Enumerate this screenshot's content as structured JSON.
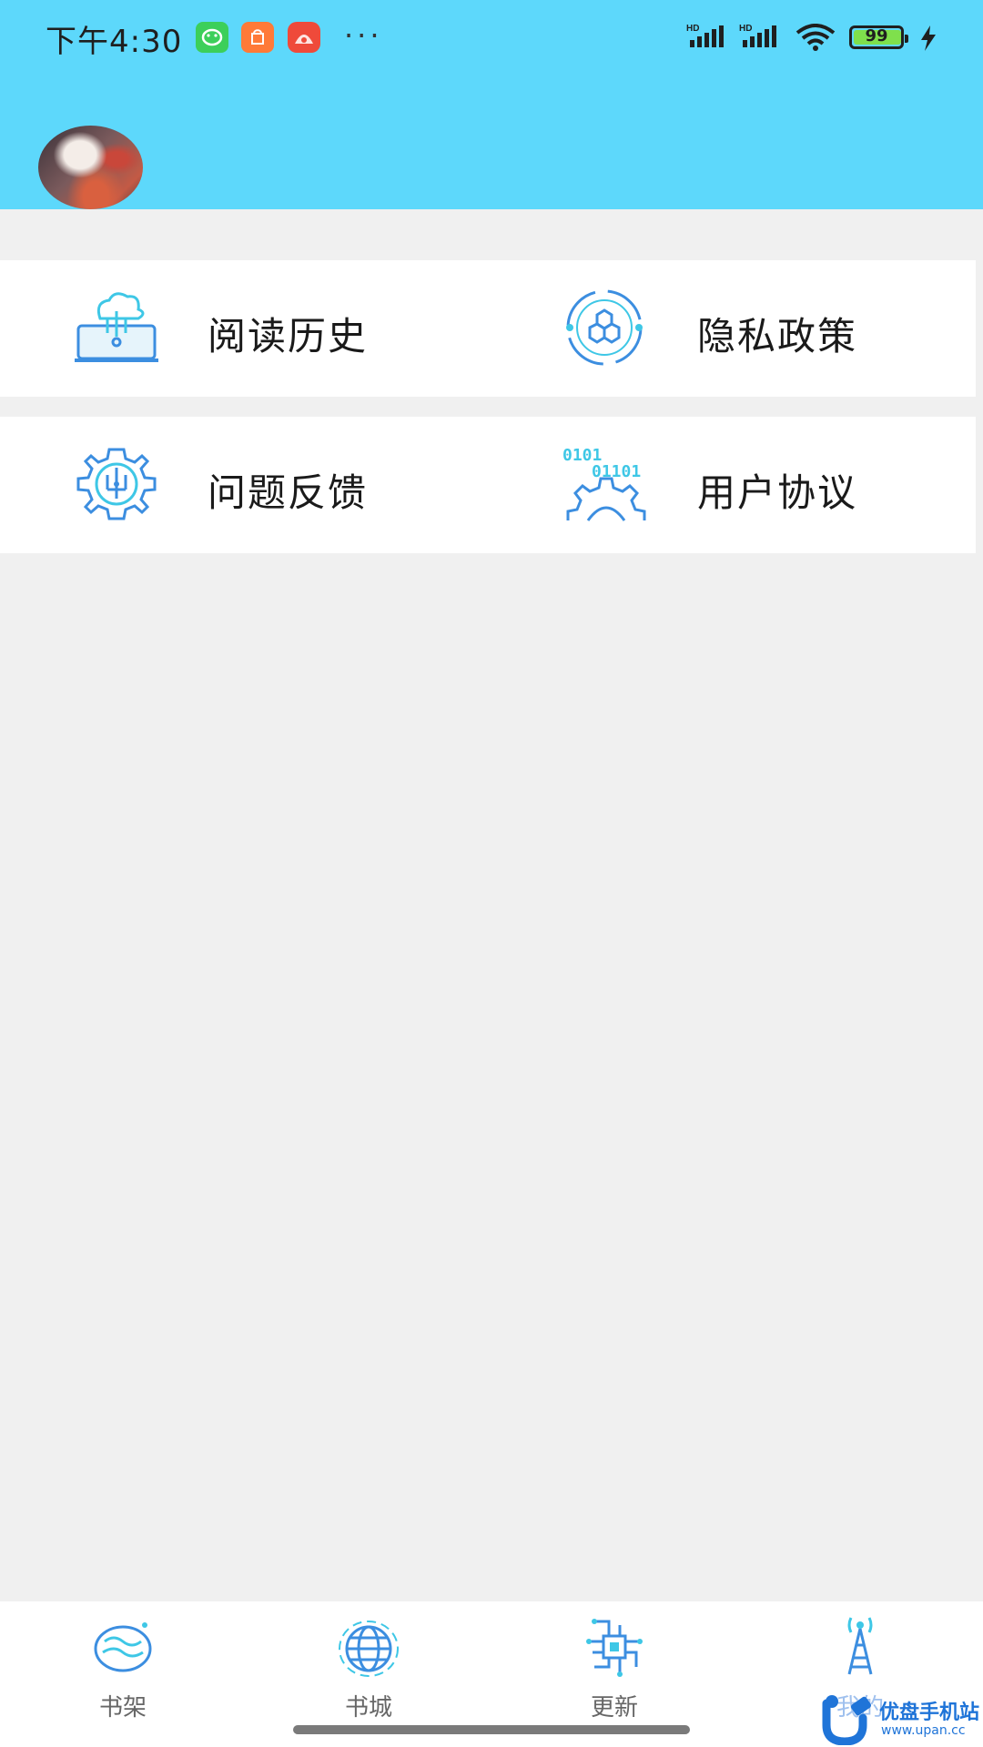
{
  "status_bar": {
    "time": "下午4:30",
    "more": "···",
    "battery_level": "99",
    "network_labels": [
      "HD",
      "HD"
    ]
  },
  "header": {
    "background_color": "#5dd8fb",
    "avatar_icon": "user-avatar"
  },
  "menu": {
    "rows": [
      [
        {
          "label": "阅读历史",
          "icon": "cloud-laptop-icon"
        },
        {
          "label": "隐私政策",
          "icon": "hexagon-network-icon"
        }
      ],
      [
        {
          "label": "问题反馈",
          "icon": "gear-circuit-icon"
        },
        {
          "label": "用户协议",
          "icon": "binary-gear-icon"
        }
      ]
    ]
  },
  "bottom_nav": {
    "tabs": [
      {
        "label": "书架",
        "icon": "globe-wave-icon",
        "active": false
      },
      {
        "label": "书城",
        "icon": "globe-grid-icon",
        "active": false
      },
      {
        "label": "更新",
        "icon": "chip-icon",
        "active": false
      },
      {
        "label": "我的",
        "icon": "tower-icon",
        "active": true
      }
    ]
  },
  "watermark": {
    "name": "优盘手机站",
    "url": "www.upan.cc"
  },
  "colors": {
    "accent": "#5dd8fb",
    "icon_blue": "#3c8ee0",
    "icon_cyan": "#3ec7e6",
    "page_bg": "#f0f0f0",
    "active_tab": "#9fc0ee"
  }
}
